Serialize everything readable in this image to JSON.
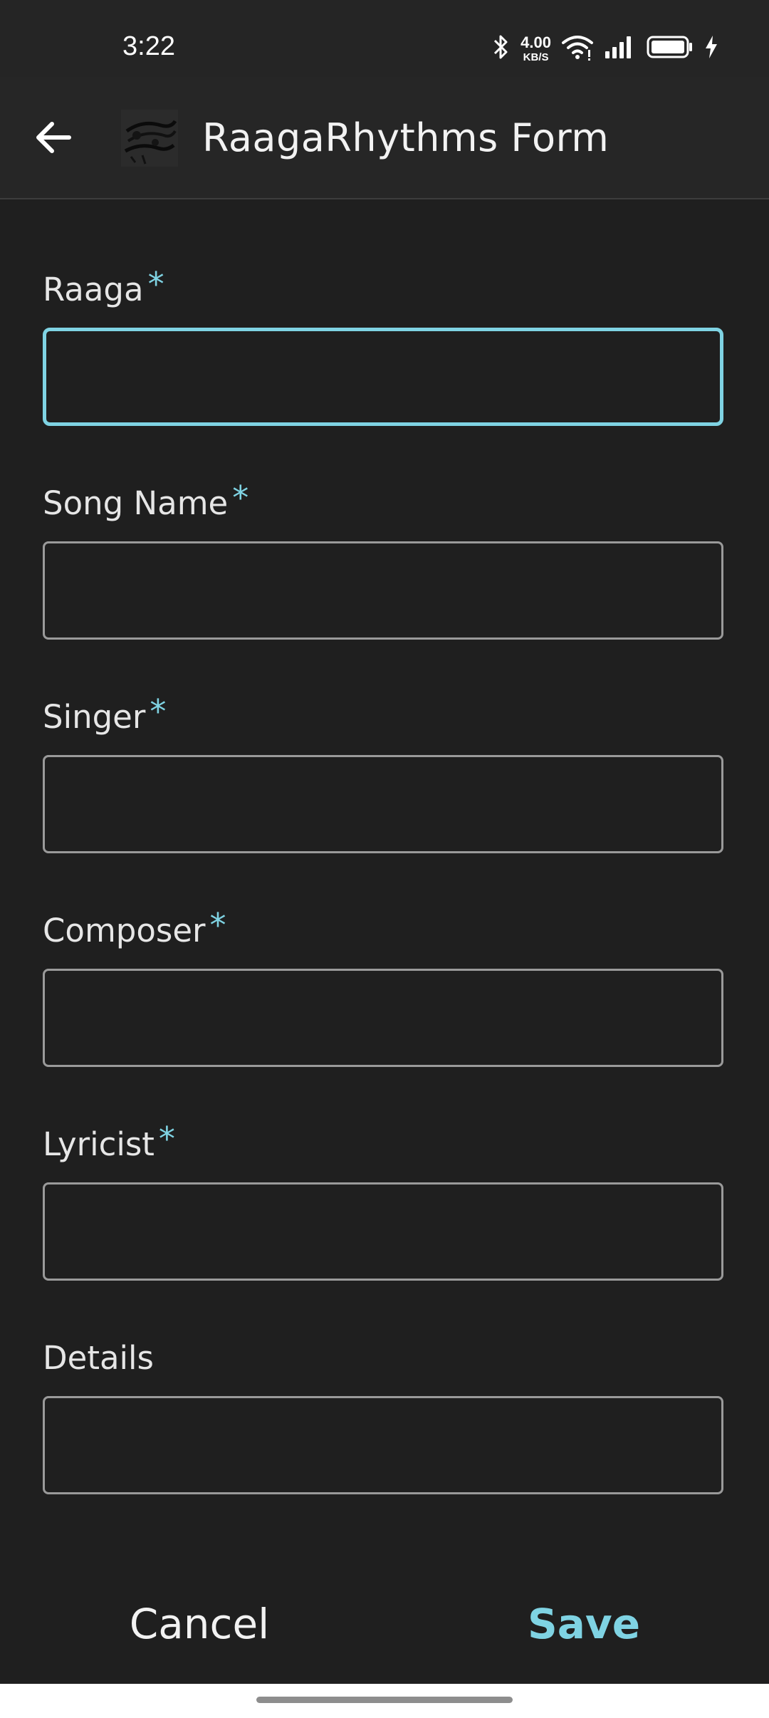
{
  "status_bar": {
    "time": "3:22",
    "net_speed_value": "4.00",
    "net_speed_unit": "KB/S",
    "icons": [
      "bluetooth-icon",
      "wifi-icon",
      "signal-icon",
      "battery-icon",
      "charging-icon"
    ]
  },
  "app_bar": {
    "title": "RaagaRhythms Form",
    "back_icon": "arrow-left-icon",
    "logo_icon": "app-logo-icon"
  },
  "form": {
    "required_marker": "*",
    "fields": [
      {
        "label": "Raaga",
        "required": true,
        "value": "",
        "focused": true
      },
      {
        "label": "Song Name",
        "required": true,
        "value": ""
      },
      {
        "label": "Singer",
        "required": true,
        "value": ""
      },
      {
        "label": "Composer",
        "required": true,
        "value": ""
      },
      {
        "label": "Lyricist",
        "required": true,
        "value": ""
      },
      {
        "label": "Details",
        "required": false,
        "value": ""
      }
    ]
  },
  "actions": {
    "cancel_label": "Cancel",
    "save_label": "Save"
  },
  "colors": {
    "accent": "#7fd3e3",
    "background": "#1f1f1f",
    "app_bar": "#262626",
    "input_border": "#9a9a9a"
  }
}
